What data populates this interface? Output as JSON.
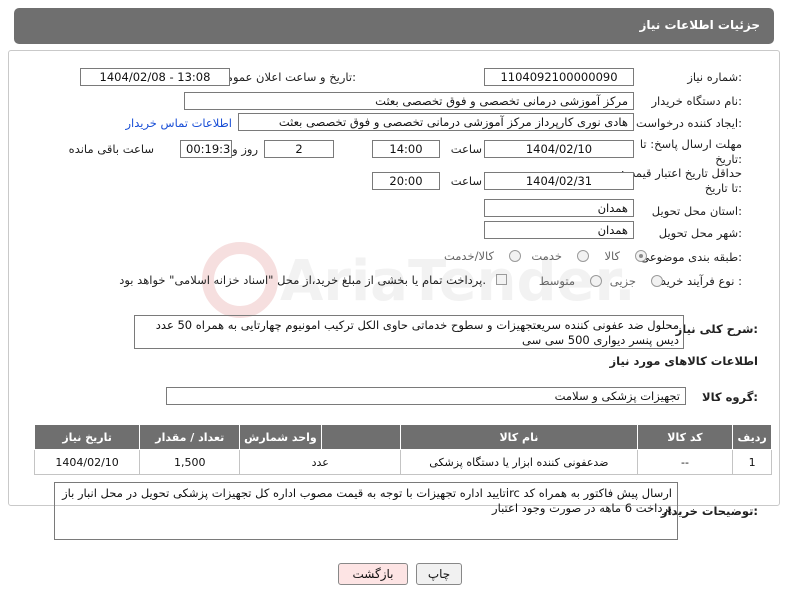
{
  "header": {
    "title": "جزئیات اطلاعات نیاز"
  },
  "fields": {
    "need_number_label": "شماره نیاز:",
    "need_number": "1104092100000090",
    "announce_label": "تاریخ و ساعت اعلان عمومی:",
    "announce_value": "1404/02/08 - 13:08",
    "buyer_org_label": "نام دستگاه خریدار:",
    "buyer_org": "مرکز آموزشی درمانی تخصصی و فوق تخصصی بعثت",
    "requester_label": "ایجاد کننده درخواست:",
    "requester": "هادی نوری کارپرداز مرکز آموزشی درمانی تخصصی و فوق تخصصی بعثت",
    "contact_link": "اطلاعات تماس خریدار",
    "deadline_label": "مهلت ارسال پاسخ: تا تاریخ:",
    "deadline_date": "1404/02/10",
    "time_label": "ساعت",
    "deadline_time": "14:00",
    "days_value": "2",
    "days_label": "روز و",
    "remaining_value": "00:19:30",
    "remaining_label": "ساعت باقی مانده",
    "price_validity_label": "حداقل تاریخ اعتبار قیمت: تا تاریخ:",
    "price_date": "1404/02/31",
    "price_time": "20:00",
    "province_label": "استان محل تحویل:",
    "province": "همدان",
    "city_label": "شهر محل تحویل:",
    "city": "همدان",
    "category_label": "طبقه بندی موضوعی:",
    "category_options": [
      "کالا",
      "خدمت",
      "کالا/خدمت"
    ],
    "process_label": "نوع فرآیند خرید :",
    "process_options": [
      "جزیی",
      "متوسط"
    ],
    "payment_note": "پرداخت تمام یا بخشی از مبلغ خرید،از محل \"اسناد خزانه اسلامی\" خواهد بود.",
    "description_label": "شرح کلی نیاز:",
    "description": "محلول ضد عفونی کننده سریعتجهیزات و سطوح خدماتی حاوی الکل ترکیب امونیوم چهارتایی به همراه 50 عدد دیس پنسر دیواری 500 سی سی"
  },
  "goods_section": {
    "title": "اطلاعات کالاهای مورد نیاز",
    "group_label": "گروه کالا:",
    "group_value": "تجهیزات پزشکی و سلامت"
  },
  "table": {
    "headers": [
      "ردیف",
      "کد کالا",
      "نام کالا",
      "واحد شمارش",
      "تعداد / مقدار",
      "تاریخ نیاز"
    ],
    "rows": [
      [
        "1",
        "--",
        "ضدعفونی کننده ابزار یا دستگاه پزشکی",
        "عدد",
        "1,500",
        "1404/02/10"
      ]
    ]
  },
  "buyer_notes": {
    "label": "توضیحات خریدار:",
    "text": "ارسال پیش فاکتور به همراه کد ircتایید اداره تجهیزات  با توجه به قیمت مصوب اداره کل تجهیزات پزشکی تحویل در محل انبار باز پرداخت 6 ماهه در صورت وجود اعتبار"
  },
  "buttons": {
    "print": "چاپ",
    "back": "بازگشت"
  },
  "watermark": "AriaTender.net",
  "colors": {
    "header": "#6f6f6f",
    "link": "#1a4fd6",
    "back_button": "#fde4e4"
  }
}
